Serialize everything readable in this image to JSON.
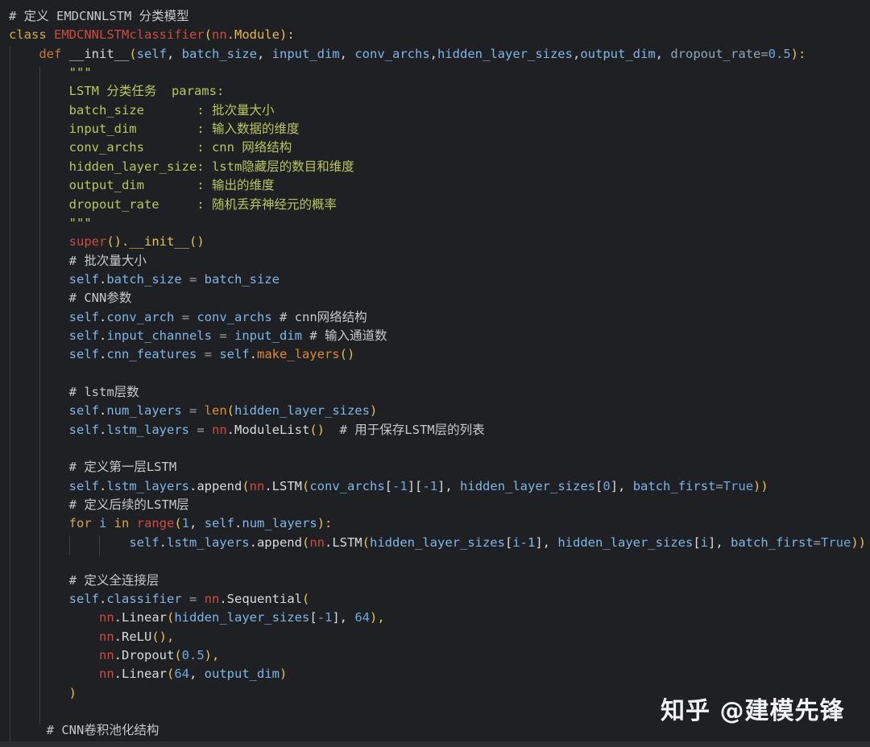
{
  "editor": {
    "lines": [
      [
        {
          "t": "# 定义 EMDCNNLSTM 分类模型",
          "c": "comment"
        }
      ],
      [
        {
          "t": "class ",
          "c": "keyword"
        },
        {
          "t": "EMDCNNLSTMclassifier",
          "c": "classname"
        },
        {
          "t": "(",
          "c": "punct"
        },
        {
          "t": "nn",
          "c": "module"
        },
        {
          "t": ".Module",
          "c": "type"
        },
        {
          "t": "):",
          "c": "punct"
        }
      ],
      [
        {
          "t": "    def ",
          "c": "def"
        },
        {
          "t": "__init__",
          "c": "fn"
        },
        {
          "t": "(",
          "c": "punct"
        },
        {
          "t": "self",
          "c": "param"
        },
        {
          "t": ", ",
          "c": "plain"
        },
        {
          "t": "batch_size",
          "c": "param"
        },
        {
          "t": ", ",
          "c": "plain"
        },
        {
          "t": "input_dim",
          "c": "param"
        },
        {
          "t": ", ",
          "c": "plain"
        },
        {
          "t": "conv_archs",
          "c": "param"
        },
        {
          "t": ",",
          "c": "plain"
        },
        {
          "t": "hidden_layer_sizes",
          "c": "param"
        },
        {
          "t": ",",
          "c": "plain"
        },
        {
          "t": "output_dim",
          "c": "param"
        },
        {
          "t": ", ",
          "c": "plain"
        },
        {
          "t": "dropout_rate",
          "c": "param-dim"
        },
        {
          "t": "=",
          "c": "equal"
        },
        {
          "t": "0.5",
          "c": "number"
        },
        {
          "t": "):",
          "c": "punct"
        }
      ],
      [
        {
          "t": "        \"\"\"",
          "c": "doc"
        }
      ],
      [
        {
          "t": "        LSTM 分类任务  params:",
          "c": "doc"
        }
      ],
      [
        {
          "t": "        batch_size       : 批次量大小",
          "c": "doc"
        }
      ],
      [
        {
          "t": "        input_dim        : 输入数据的维度",
          "c": "doc"
        }
      ],
      [
        {
          "t": "        conv_archs       : cnn 网络结构",
          "c": "doc"
        }
      ],
      [
        {
          "t": "        hidden_layer_size: lstm隐藏层的数目和维度",
          "c": "doc"
        }
      ],
      [
        {
          "t": "        output_dim       : 输出的维度",
          "c": "doc"
        }
      ],
      [
        {
          "t": "        dropout_rate     : 随机丢弃神经元的概率",
          "c": "doc"
        }
      ],
      [
        {
          "t": "        \"\"\"",
          "c": "doc"
        }
      ],
      [
        {
          "t": "        ",
          "c": "plain"
        },
        {
          "t": "super",
          "c": "builtin-red"
        },
        {
          "t": "().",
          "c": "punct"
        },
        {
          "t": "__init__",
          "c": "punct"
        },
        {
          "t": "()",
          "c": "punct"
        }
      ],
      [
        {
          "t": "        # 批次量大小",
          "c": "comment"
        }
      ],
      [
        {
          "t": "        ",
          "c": "plain"
        },
        {
          "t": "self",
          "c": "self"
        },
        {
          "t": ".",
          "c": "plain"
        },
        {
          "t": "batch_size",
          "c": "attr"
        },
        {
          "t": " = ",
          "c": "equal"
        },
        {
          "t": "batch_size",
          "c": "attr"
        }
      ],
      [
        {
          "t": "        # CNN参数",
          "c": "comment"
        }
      ],
      [
        {
          "t": "        ",
          "c": "plain"
        },
        {
          "t": "self",
          "c": "self"
        },
        {
          "t": ".",
          "c": "plain"
        },
        {
          "t": "conv_arch",
          "c": "attr"
        },
        {
          "t": " = ",
          "c": "equal"
        },
        {
          "t": "conv_archs",
          "c": "attr"
        },
        {
          "t": " # cnn网络结构",
          "c": "comment"
        }
      ],
      [
        {
          "t": "        ",
          "c": "plain"
        },
        {
          "t": "self",
          "c": "self"
        },
        {
          "t": ".",
          "c": "plain"
        },
        {
          "t": "input_channels",
          "c": "attr"
        },
        {
          "t": " = ",
          "c": "equal"
        },
        {
          "t": "input_dim",
          "c": "attr"
        },
        {
          "t": " # 输入通道数",
          "c": "comment"
        }
      ],
      [
        {
          "t": "        ",
          "c": "plain"
        },
        {
          "t": "self",
          "c": "self"
        },
        {
          "t": ".",
          "c": "plain"
        },
        {
          "t": "cnn_features",
          "c": "attr"
        },
        {
          "t": " = ",
          "c": "equal"
        },
        {
          "t": "self",
          "c": "self"
        },
        {
          "t": ".",
          "c": "plain"
        },
        {
          "t": "make_layers",
          "c": "method"
        },
        {
          "t": "()",
          "c": "punct"
        }
      ],
      [
        {
          "t": "",
          "c": "plain"
        }
      ],
      [
        {
          "t": "        # lstm层数",
          "c": "comment"
        }
      ],
      [
        {
          "t": "        ",
          "c": "plain"
        },
        {
          "t": "self",
          "c": "self"
        },
        {
          "t": ".",
          "c": "plain"
        },
        {
          "t": "num_layers",
          "c": "attr"
        },
        {
          "t": " = ",
          "c": "equal"
        },
        {
          "t": "len",
          "c": "builtin"
        },
        {
          "t": "(",
          "c": "punct"
        },
        {
          "t": "hidden_layer_sizes",
          "c": "attr"
        },
        {
          "t": ")",
          "c": "punct"
        }
      ],
      [
        {
          "t": "        ",
          "c": "plain"
        },
        {
          "t": "self",
          "c": "self"
        },
        {
          "t": ".",
          "c": "plain"
        },
        {
          "t": "lstm_layers",
          "c": "attr"
        },
        {
          "t": " = ",
          "c": "equal"
        },
        {
          "t": "nn",
          "c": "module"
        },
        {
          "t": ".ModuleList",
          "c": "fn"
        },
        {
          "t": "()",
          "c": "punct"
        },
        {
          "t": "  # 用于保存LSTM层的列表",
          "c": "comment"
        }
      ],
      [
        {
          "t": "",
          "c": "plain"
        }
      ],
      [
        {
          "t": "        # 定义第一层LSTM",
          "c": "comment"
        }
      ],
      [
        {
          "t": "        ",
          "c": "plain"
        },
        {
          "t": "self",
          "c": "self"
        },
        {
          "t": ".",
          "c": "plain"
        },
        {
          "t": "lstm_layers",
          "c": "attr"
        },
        {
          "t": ".append",
          "c": "fn"
        },
        {
          "t": "(",
          "c": "punct"
        },
        {
          "t": "nn",
          "c": "module"
        },
        {
          "t": ".LSTM",
          "c": "fn"
        },
        {
          "t": "(",
          "c": "punct"
        },
        {
          "t": "conv_archs",
          "c": "attr"
        },
        {
          "t": "[",
          "c": "plain"
        },
        {
          "t": "-1",
          "c": "number"
        },
        {
          "t": "][",
          "c": "plain"
        },
        {
          "t": "-1",
          "c": "number"
        },
        {
          "t": "], ",
          "c": "plain"
        },
        {
          "t": "hidden_layer_sizes",
          "c": "attr"
        },
        {
          "t": "[",
          "c": "plain"
        },
        {
          "t": "0",
          "c": "number"
        },
        {
          "t": "], ",
          "c": "plain"
        },
        {
          "t": "batch_first",
          "c": "attr"
        },
        {
          "t": "=",
          "c": "equal"
        },
        {
          "t": "True",
          "c": "bool"
        },
        {
          "t": "))",
          "c": "punct"
        }
      ],
      [
        {
          "t": "        # 定义后续的LSTM层",
          "c": "comment"
        }
      ],
      [
        {
          "t": "        for ",
          "c": "keyword"
        },
        {
          "t": "i",
          "c": "attr"
        },
        {
          "t": " in ",
          "c": "keyword"
        },
        {
          "t": "range",
          "c": "builtin-red"
        },
        {
          "t": "(",
          "c": "punct"
        },
        {
          "t": "1",
          "c": "number"
        },
        {
          "t": ", ",
          "c": "plain"
        },
        {
          "t": "self",
          "c": "self"
        },
        {
          "t": ".",
          "c": "plain"
        },
        {
          "t": "num_layers",
          "c": "attr"
        },
        {
          "t": "):",
          "c": "punct"
        }
      ],
      [
        {
          "t": "                ",
          "c": "plain"
        },
        {
          "t": "self",
          "c": "self"
        },
        {
          "t": ".",
          "c": "plain"
        },
        {
          "t": "lstm_layers",
          "c": "attr"
        },
        {
          "t": ".append",
          "c": "fn"
        },
        {
          "t": "(",
          "c": "punct"
        },
        {
          "t": "nn",
          "c": "module"
        },
        {
          "t": ".LSTM",
          "c": "fn"
        },
        {
          "t": "(",
          "c": "punct"
        },
        {
          "t": "hidden_layer_sizes",
          "c": "attr"
        },
        {
          "t": "[",
          "c": "plain"
        },
        {
          "t": "i-1",
          "c": "attr"
        },
        {
          "t": "], ",
          "c": "plain"
        },
        {
          "t": "hidden_layer_sizes",
          "c": "attr"
        },
        {
          "t": "[",
          "c": "plain"
        },
        {
          "t": "i",
          "c": "attr"
        },
        {
          "t": "], ",
          "c": "plain"
        },
        {
          "t": "batch_first",
          "c": "attr"
        },
        {
          "t": "=",
          "c": "equal"
        },
        {
          "t": "True",
          "c": "bool"
        },
        {
          "t": "))",
          "c": "punct"
        }
      ],
      [
        {
          "t": "",
          "c": "plain"
        }
      ],
      [
        {
          "t": "        # 定义全连接层",
          "c": "comment"
        }
      ],
      [
        {
          "t": "        ",
          "c": "plain"
        },
        {
          "t": "self",
          "c": "self"
        },
        {
          "t": ".",
          "c": "plain"
        },
        {
          "t": "classifier",
          "c": "attr"
        },
        {
          "t": " = ",
          "c": "equal"
        },
        {
          "t": "nn",
          "c": "module"
        },
        {
          "t": ".Sequential",
          "c": "fn"
        },
        {
          "t": "(",
          "c": "punct"
        }
      ],
      [
        {
          "t": "            ",
          "c": "plain"
        },
        {
          "t": "nn",
          "c": "module"
        },
        {
          "t": ".Linear",
          "c": "fn"
        },
        {
          "t": "(",
          "c": "punct"
        },
        {
          "t": "hidden_layer_sizes",
          "c": "attr"
        },
        {
          "t": "[",
          "c": "plain"
        },
        {
          "t": "-1",
          "c": "number"
        },
        {
          "t": "], ",
          "c": "plain"
        },
        {
          "t": "64",
          "c": "number"
        },
        {
          "t": "),",
          "c": "punct"
        }
      ],
      [
        {
          "t": "            ",
          "c": "plain"
        },
        {
          "t": "nn",
          "c": "module"
        },
        {
          "t": ".ReLU",
          "c": "fn"
        },
        {
          "t": "(),",
          "c": "punct"
        }
      ],
      [
        {
          "t": "            ",
          "c": "plain"
        },
        {
          "t": "nn",
          "c": "module"
        },
        {
          "t": ".Dropout",
          "c": "fn"
        },
        {
          "t": "(",
          "c": "punct"
        },
        {
          "t": "0.5",
          "c": "number"
        },
        {
          "t": "),",
          "c": "punct"
        }
      ],
      [
        {
          "t": "            ",
          "c": "plain"
        },
        {
          "t": "nn",
          "c": "module"
        },
        {
          "t": ".Linear",
          "c": "fn"
        },
        {
          "t": "(",
          "c": "punct"
        },
        {
          "t": "64",
          "c": "number"
        },
        {
          "t": ", ",
          "c": "plain"
        },
        {
          "t": "output_dim",
          "c": "attr"
        },
        {
          "t": ")",
          "c": "punct"
        }
      ],
      [
        {
          "t": "        )",
          "c": "punct"
        }
      ],
      [
        {
          "t": "",
          "c": "plain"
        }
      ],
      [
        {
          "t": "     # CNN卷积池化结构",
          "c": "comment"
        }
      ]
    ]
  },
  "watermark": {
    "text": "知乎 @建模先锋"
  }
}
